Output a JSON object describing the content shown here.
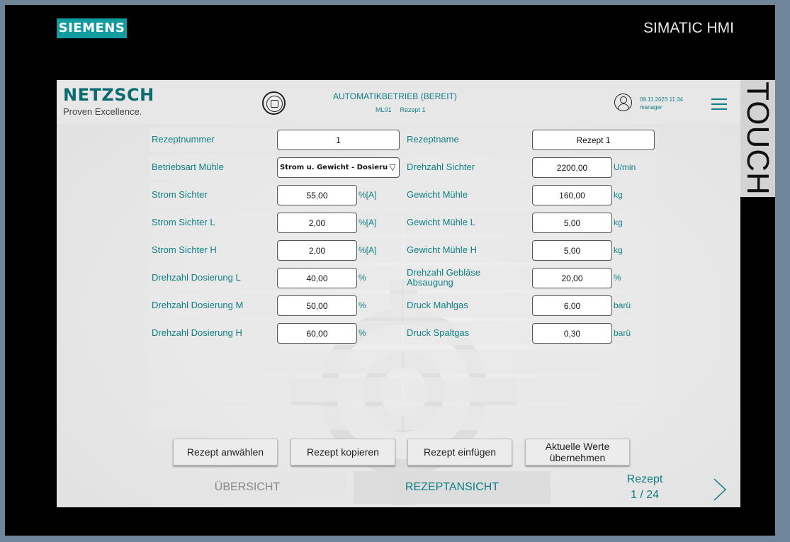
{
  "device": {
    "brand_logo": "SIEMENS",
    "model": "SIMATIC HMI",
    "side_label": "TOUCH"
  },
  "header": {
    "company": "NETZSCH",
    "tagline": "Proven Excellence",
    "tagline_dot": ".",
    "mode_title": "AUTOMATIKBETRIEB (BEREIT)",
    "machine_id": "ML01",
    "recipe_label": "Rezept 1",
    "datetime": "09.11.2023 11:34",
    "user": "manager",
    "stop_icon": "stop-circle-icon",
    "user_icon": "user-icon",
    "menu_icon": "hamburger-menu-icon"
  },
  "form": {
    "left": [
      {
        "label": "Rezeptnummer",
        "value": "1",
        "unit": ""
      },
      {
        "label": "Betriebsart Mühle",
        "value": "Strom u. Gewicht - Dosierung",
        "unit": ""
      },
      {
        "label": "Strom Sichter",
        "value": "55,00",
        "unit": "%[A]"
      },
      {
        "label": "Strom Sichter L",
        "value": "2,00",
        "unit": "%[A]"
      },
      {
        "label": "Strom Sichter H",
        "value": "2,00",
        "unit": "%[A]"
      },
      {
        "label": "Drehzahl Dosierung L",
        "value": "40,00",
        "unit": "%"
      },
      {
        "label": "Drehzahl Dosierung M",
        "value": "50,00",
        "unit": "%"
      },
      {
        "label": "Drehzahl Dosierung H",
        "value": "60,00",
        "unit": "%"
      }
    ],
    "right": [
      {
        "label": "Rezeptname",
        "value": "Rezept 1",
        "unit": ""
      },
      {
        "label": "Drehzahl Sichter",
        "value": "2200,00",
        "unit": "U/min"
      },
      {
        "label": "Gewicht Mühle",
        "value": "160,00",
        "unit": "kg"
      },
      {
        "label": "Gewicht Mühle L",
        "value": "5,00",
        "unit": "kg"
      },
      {
        "label": "Gewicht Mühle H",
        "value": "5,00",
        "unit": "kg"
      },
      {
        "label": "Drehzahl Gebläse Absaugung",
        "value": "20,00",
        "unit": "%"
      },
      {
        "label": "Druck Mahlgas",
        "value": "6,00",
        "unit": "barü"
      },
      {
        "label": "Druck Spaltgas",
        "value": "0,30",
        "unit": "barü"
      }
    ]
  },
  "buttons": {
    "select": "Rezept anwählen",
    "copy": "Rezept kopieren",
    "paste": "Rezept einfügen",
    "apply": "Aktuelle Werte übernehmen"
  },
  "nav": {
    "overview": "ÜBERSICHT",
    "recipe_view": "REZEPTANSICHT",
    "pager_title": "Rezept",
    "pager_count": "1 / 24",
    "next_icon": "chevron-right-icon"
  }
}
